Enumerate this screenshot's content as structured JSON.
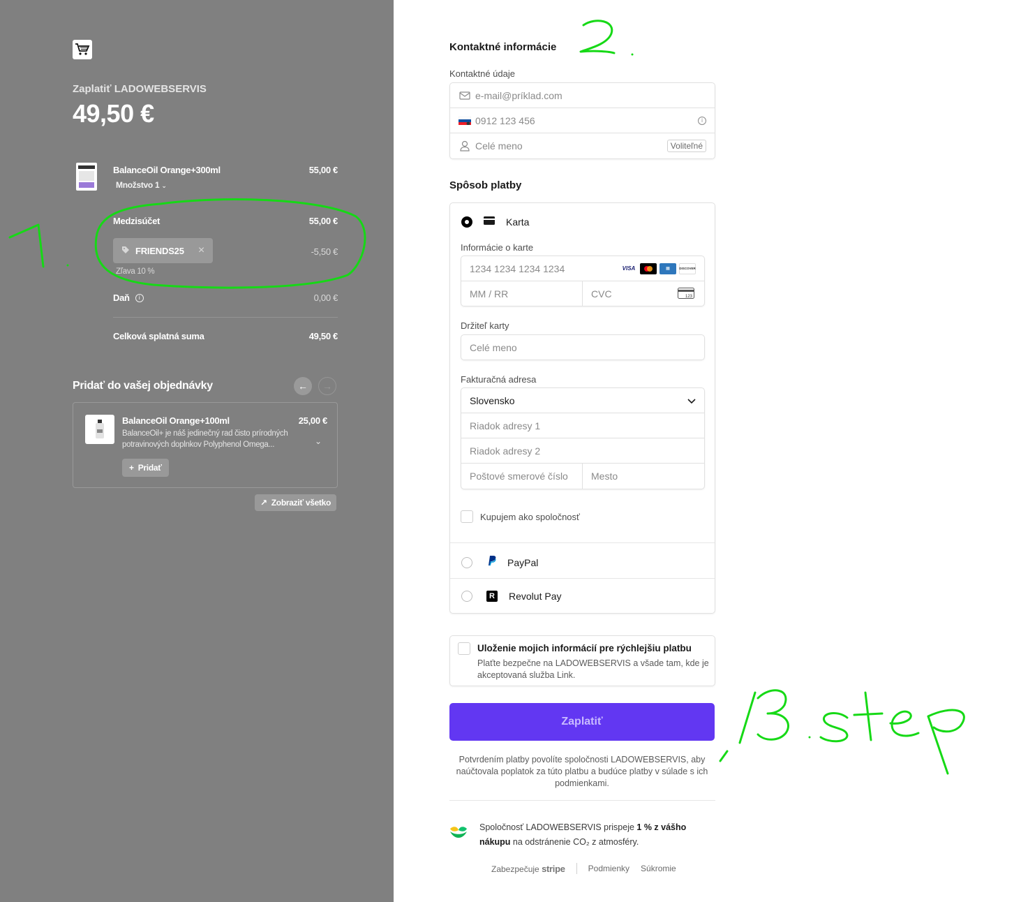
{
  "left": {
    "pay_to": "Zaplatiť LADOWEBSERVIS",
    "amount": "49,50 €",
    "product": {
      "name": "BalanceOil Orange+300ml",
      "price": "55,00 €",
      "quantity": "Množstvo 1"
    },
    "subtotal": {
      "label": "Medzisúčet",
      "value": "55,00 €"
    },
    "promo": {
      "code": "FRIENDS25",
      "value": "-5,50 €",
      "note": "Zľava 10 %"
    },
    "tax": {
      "label": "Daň",
      "value": "0,00 €"
    },
    "total": {
      "label": "Celková splatná suma",
      "value": "49,50 €"
    },
    "upsell": {
      "title": "Pridať do vašej objednávky",
      "item": {
        "name": "BalanceOil Orange+100ml",
        "price": "25,00 €",
        "desc_line1": "BalanceOil+ je náš jedinečný rad čisto prírodných",
        "desc_line2": "potravinových doplnkov Polyphenol Omega...",
        "add_label": "Pridať"
      },
      "show_all": "Zobraziť všetko"
    }
  },
  "contact": {
    "title": "Kontaktné informácie",
    "label": "Kontaktné údaje",
    "email_placeholder": "e-mail@príklad.com",
    "phone_placeholder": "0912 123 456",
    "name_placeholder": "Celé meno",
    "optional": "Voliteľné"
  },
  "payment": {
    "title": "Spôsob platby",
    "card_label": "Karta",
    "card_info_label": "Informácie o karte",
    "card_number_placeholder": "1234 1234 1234 1234",
    "expiry_placeholder": "MM / RR",
    "cvc_placeholder": "CVC",
    "holder_label": "Držiteľ karty",
    "holder_placeholder": "Celé meno",
    "billing_label": "Fakturačná adresa",
    "country": "Slovensko",
    "address1_placeholder": "Riadok adresy 1",
    "address2_placeholder": "Riadok adresy 2",
    "zip_placeholder": "Poštové smerové číslo",
    "city_placeholder": "Mesto",
    "company_label": "Kupujem ako spoločnosť",
    "paypal_label": "PayPal",
    "revolut_label": "Revolut Pay",
    "card_brands": [
      "VISA",
      "MC",
      "AMEX",
      "DISCOVER"
    ],
    "cvc_icon_text": "123"
  },
  "save_info": {
    "title": "Uloženie mojich informácií pre rýchlejšiu platbu",
    "line1": "Plaťte bezpečne na LADOWEBSERVIS a všade tam, kde je",
    "line2": "akceptovaná služba Link."
  },
  "pay_button": "Zaplatiť",
  "terms": {
    "line1": "Potvrdením platby povolíte spoločnosti LADOWEBSERVIS, aby",
    "line2": "naúčtovala poplatok za túto platbu a budúce platby v súlade s ich",
    "line3": "podmienkami."
  },
  "climate": {
    "part1": "Spoločnosť LADOWEBSERVIS prispeje ",
    "bold1": "1 % z vášho",
    "bold2": "nákupu",
    "part2": " na odstránenie CO₂ z atmosféry."
  },
  "footer": {
    "powered": "Zabezpečuje",
    "stripe": "stripe",
    "terms": "Podmienky",
    "privacy": "Súkromie"
  },
  "colors": {
    "accent": "#6237f2",
    "left_bg": "#808080",
    "annotation": "#16d916"
  }
}
